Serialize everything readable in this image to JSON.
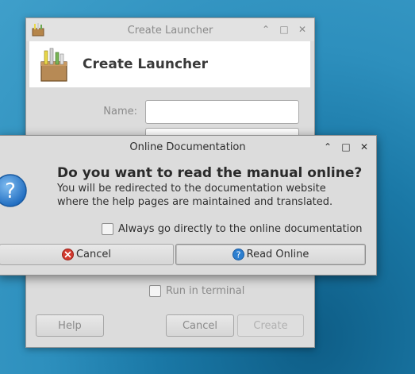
{
  "back_window": {
    "title": "Create Launcher",
    "heading": "Create Launcher",
    "name_label": "Name:",
    "name_value": "",
    "run_in_terminal_label": "Run in terminal",
    "help_label": "Help",
    "cancel_label": "Cancel",
    "create_label": "Create"
  },
  "dialog": {
    "title": "Online Documentation",
    "question": "Do you want to read the manual online?",
    "message_line1": "You will be redirected to the documentation website",
    "message_line2": "where the help pages are maintained and translated.",
    "checkbox_label": "Always go directly to the online documentation",
    "cancel_label": "Cancel",
    "read_online_label": "Read Online"
  },
  "icons": {
    "cancel": "cancel-icon",
    "help": "help-icon",
    "window_controls": [
      "minimize-icon",
      "maximize-icon",
      "close-icon"
    ]
  },
  "colors": {
    "help_blue": "#2c7fd0",
    "cancel_red": "#d23a2f",
    "desktop_blue": "#1a78a6"
  }
}
